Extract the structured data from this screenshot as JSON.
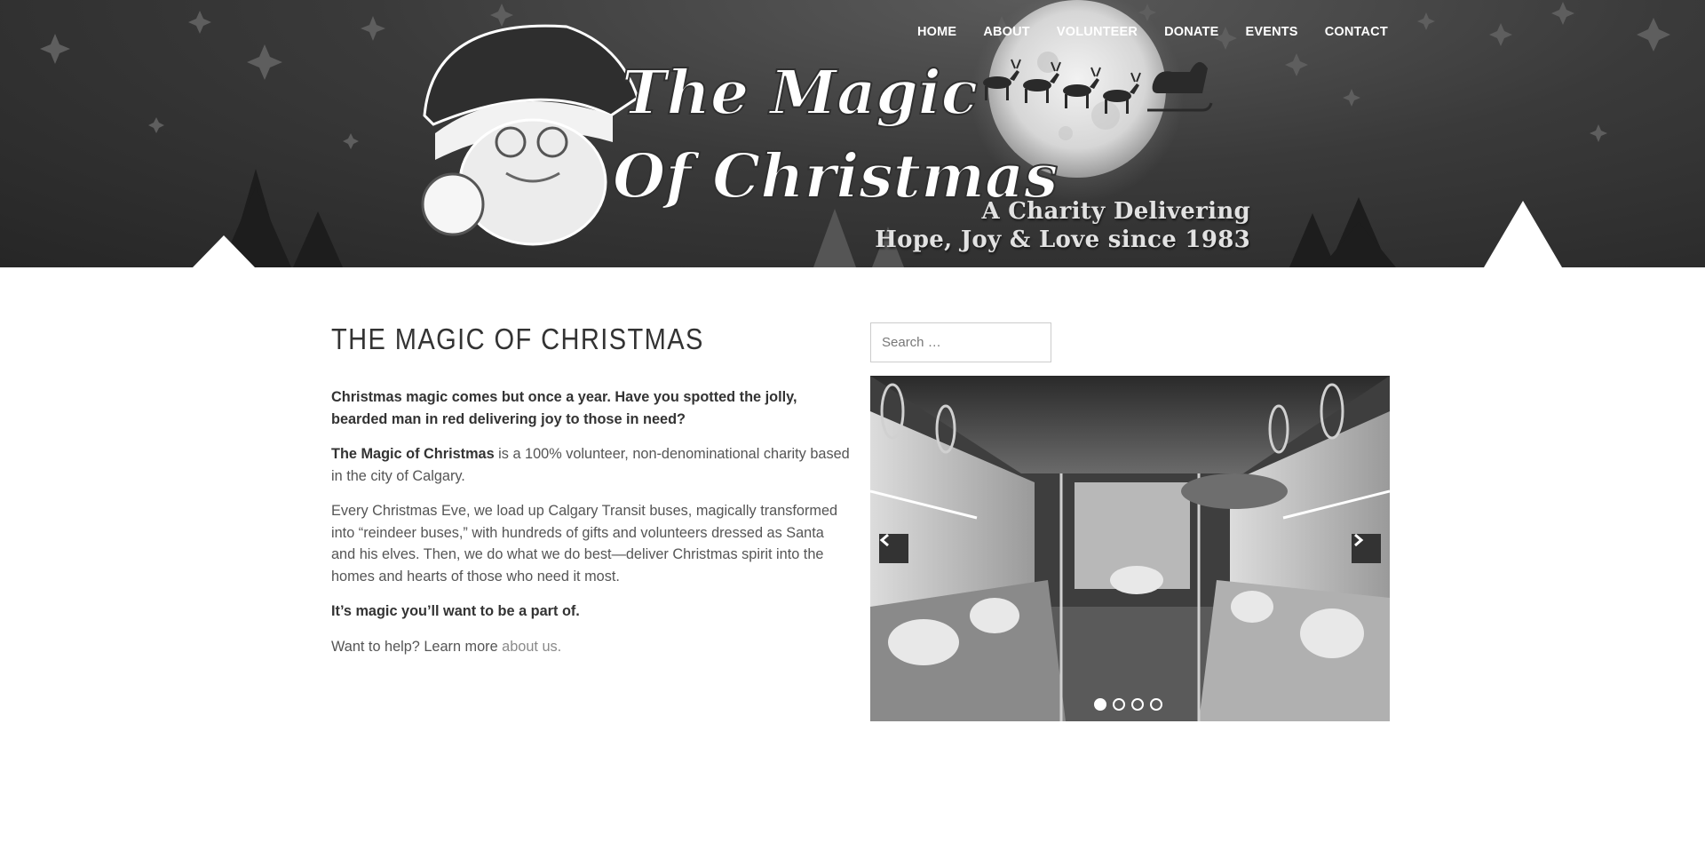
{
  "header": {
    "logo_text_line1": "The Magic",
    "logo_text_line2": "Of Christmas",
    "tagline_line1": "A Charity Delivering",
    "tagline_line2": "Hope, Joy & Love since 1983"
  },
  "nav": {
    "items": [
      {
        "label": "HOME"
      },
      {
        "label": "ABOUT"
      },
      {
        "label": "VOLUNTEER"
      },
      {
        "label": "DONATE"
      },
      {
        "label": "EVENTS"
      },
      {
        "label": "CONTACT"
      }
    ]
  },
  "main": {
    "title": "THE MAGIC OF CHRISTMAS",
    "intro": "Christmas magic comes but once a year. Have you spotted the jolly, bearded man in red delivering joy to those in need?",
    "p2_bold": "The Magic of Christmas",
    "p2_rest": " is a 100% volunteer, non-denominational charity based in the city of Calgary.",
    "p3": "Every Christmas Eve, we load up Calgary Transit buses, magically transformed into “reindeer buses,” with hundreds of gifts and volunteers dressed as Santa and his elves. Then, we do what we do best—deliver Christmas spirit into the homes and hearts of those who need it most.",
    "p4": "It’s magic you’ll want to be a part of.",
    "p5_text": "Want to help? Learn more ",
    "p5_link": "about us."
  },
  "sidebar": {
    "search_placeholder": "Search …",
    "slider": {
      "slide_count": 4,
      "active_index": 0,
      "prev_icon": "chevron-left-icon",
      "next_icon": "chevron-right-icon"
    }
  }
}
